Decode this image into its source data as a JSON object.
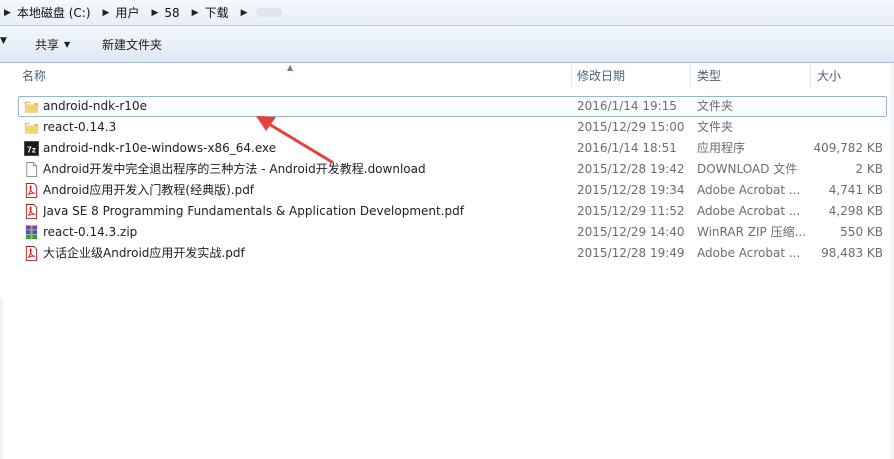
{
  "address": {
    "crumbs": [
      "本地磁盘 (C:)",
      "用户",
      "58",
      "下载"
    ]
  },
  "toolbar": {
    "share_label": "共享",
    "new_folder_label": "新建文件夹"
  },
  "columns": {
    "name": "名称",
    "modified": "修改日期",
    "type": "类型",
    "size": "大小"
  },
  "files": [
    {
      "name": "android-ndk-r10e",
      "modified": "2016/1/14 19:15",
      "type": "文件夹",
      "size": "",
      "icon": "folder-icon"
    },
    {
      "name": "react-0.14.3",
      "modified": "2015/12/29 15:00",
      "type": "文件夹",
      "size": "",
      "icon": "folder-icon"
    },
    {
      "name": "android-ndk-r10e-windows-x86_64.exe",
      "modified": "2016/1/14 18:51",
      "type": "应用程序",
      "size": "409,782 KB",
      "icon": "7z-exe-icon"
    },
    {
      "name": "Android开发中完全退出程序的三种方法 - Android开发教程.download",
      "modified": "2015/12/28 19:42",
      "type": "DOWNLOAD 文件",
      "size": "2 KB",
      "icon": "generic-file-icon"
    },
    {
      "name": "Android应用开发入门教程(经典版).pdf",
      "modified": "2015/12/28 19:34",
      "type": "Adobe Acrobat ...",
      "size": "4,741 KB",
      "icon": "pdf-icon"
    },
    {
      "name": "Java SE 8 Programming Fundamentals & Application Development.pdf",
      "modified": "2015/12/29 11:52",
      "type": "Adobe Acrobat ...",
      "size": "4,298 KB",
      "icon": "pdf-icon"
    },
    {
      "name": "react-0.14.3.zip",
      "modified": "2015/12/29 14:40",
      "type": "WinRAR ZIP 压缩...",
      "size": "550 KB",
      "icon": "winrar-icon"
    },
    {
      "name": "大话企业级Android应用开发实战.pdf",
      "modified": "2015/12/28 19:49",
      "type": "Adobe Acrobat ...",
      "size": "98,483 KB",
      "icon": "pdf-icon"
    }
  ],
  "colors": {
    "selection_border": "#99b4d1",
    "annotation_arrow": "#e8413b",
    "header_text": "#4c607a",
    "muted_text": "#6d6d6d"
  }
}
